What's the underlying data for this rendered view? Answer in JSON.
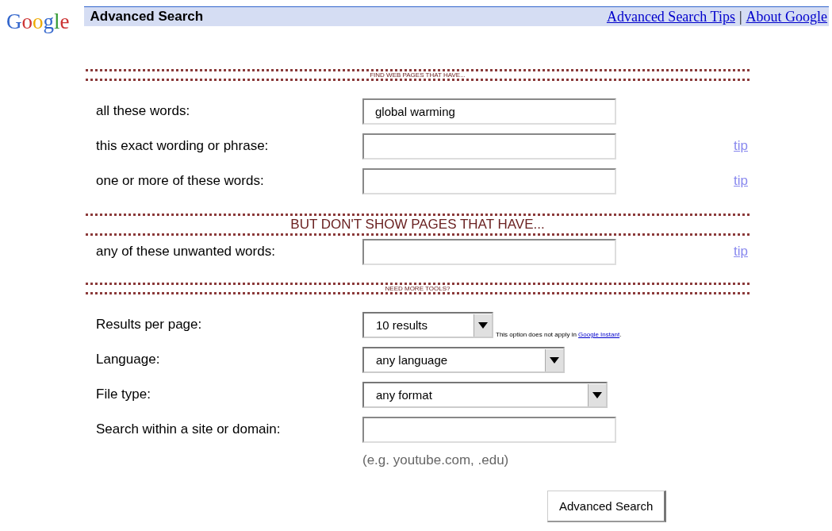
{
  "logo": "Google",
  "header": {
    "title": "Advanced Search",
    "links": [
      "Advanced Search Tips",
      "About Google"
    ],
    "separator": "|"
  },
  "sections": [
    {
      "heading": "FIND WEB PAGES THAT HAVE...",
      "rows": [
        {
          "kind": "text",
          "label": "all these words:",
          "value": "global warming"
        },
        {
          "kind": "text",
          "label": "this exact wording or phrase:",
          "value": "",
          "tip": "tip"
        },
        {
          "kind": "text",
          "label": "one or more of these words:",
          "value": "",
          "tip": "tip"
        }
      ]
    },
    {
      "heading": "BUT DON'T SHOW PAGES THAT HAVE...",
      "rows": [
        {
          "kind": "text",
          "label": "any of these unwanted words:",
          "value": "",
          "tip": "tip"
        }
      ]
    },
    {
      "heading": "NEED MORE TOOLS?",
      "rows": [
        {
          "kind": "select",
          "label": "Results per page:",
          "value": "10 results",
          "note": "This option does not apply in",
          "note_link": "Google Instant",
          "note_end": "."
        },
        {
          "kind": "select",
          "label": "Language:",
          "value": "any language"
        },
        {
          "kind": "select",
          "label": "File type:",
          "value": "any format"
        },
        {
          "kind": "text",
          "label": "Search within a site or domain:",
          "value": "",
          "hint": "(e.g. youtube.com, .edu)"
        }
      ]
    }
  ],
  "button": "Advanced Search"
}
